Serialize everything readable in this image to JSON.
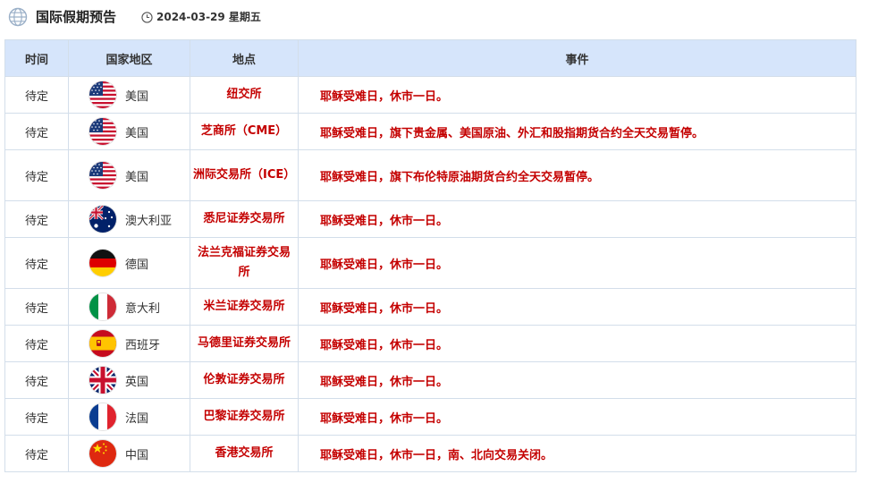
{
  "header": {
    "title": "国际假期预告",
    "date": "2024-03-29 星期五"
  },
  "table": {
    "columns": [
      "时间",
      "国家地区",
      "地点",
      "事件"
    ],
    "rows": [
      {
        "time": "待定",
        "flag": "us-flag-icon",
        "country": "美国",
        "location": "纽交所",
        "event": "耶稣受难日，休市一日。"
      },
      {
        "time": "待定",
        "flag": "us-flag-icon",
        "country": "美国",
        "location": "芝商所（CME）",
        "event": "耶稣受难日，旗下贵金属、美国原油、外汇和股指期货合约全天交易暂停。"
      },
      {
        "time": "待定",
        "flag": "us-flag-icon",
        "country": "美国",
        "location": "洲际交易所（ICE）",
        "event": "耶稣受难日，旗下布伦特原油期货合约全天交易暂停。"
      },
      {
        "time": "待定",
        "flag": "australia-flag-icon",
        "country": "澳大利亚",
        "location": "悉尼证券交易所",
        "event": "耶稣受难日，休市一日。"
      },
      {
        "time": "待定",
        "flag": "germany-flag-icon",
        "country": "德国",
        "location": "法兰克福证券交易所",
        "event": "耶稣受难日，休市一日。"
      },
      {
        "time": "待定",
        "flag": "italy-flag-icon",
        "country": "意大利",
        "location": "米兰证券交易所",
        "event": "耶稣受难日，休市一日。"
      },
      {
        "time": "待定",
        "flag": "spain-flag-icon",
        "country": "西班牙",
        "location": "马德里证券交易所",
        "event": "耶稣受难日，休市一日。"
      },
      {
        "time": "待定",
        "flag": "uk-flag-icon",
        "country": "英国",
        "location": "伦敦证券交易所",
        "event": "耶稣受难日，休市一日。"
      },
      {
        "time": "待定",
        "flag": "france-flag-icon",
        "country": "法国",
        "location": "巴黎证券交易所",
        "event": "耶稣受难日，休市一日。"
      },
      {
        "time": "待定",
        "flag": "china-flag-icon",
        "country": "中国",
        "location": "香港交易所",
        "event": "耶稣受难日，休市一日，南、北向交易关闭。"
      }
    ]
  },
  "colors": {
    "header_bg": "#d6e5fb",
    "border": "#d3deea",
    "accent_red": "#c40000"
  }
}
